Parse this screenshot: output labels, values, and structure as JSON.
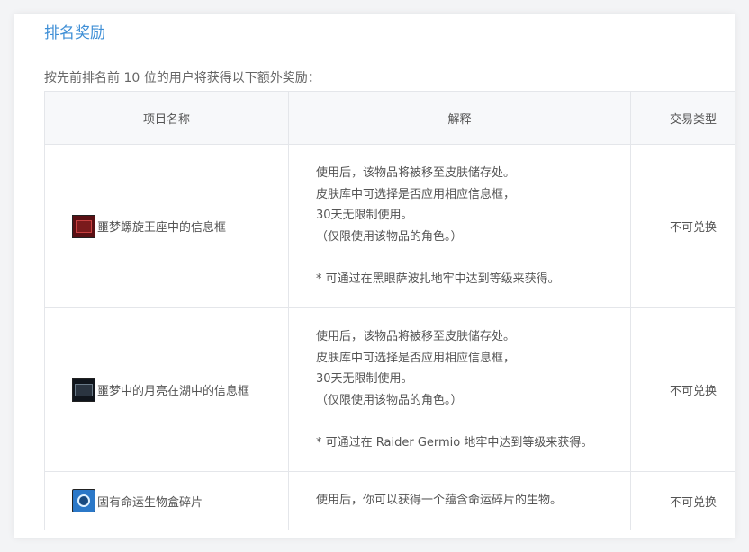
{
  "section": {
    "title": "排名奖励",
    "intro": "按先前排名前 10 位的用户将获得以下额外奖励："
  },
  "table": {
    "headers": [
      "项目名称",
      "解释",
      "交易类型"
    ],
    "rows": [
      {
        "icon": "frame-red-icon",
        "name": "噩梦螺旋王座中的信息框",
        "desc": [
          "使用后，该物品将被移至皮肤储存处。",
          "皮肤库中可选择是否应用相应信息框，",
          "30天无限制使用。",
          "（仅限使用该物品的角色。）",
          "* 可通过在黑眼萨波扎地牢中达到等级来获得。"
        ],
        "trade": "不可兑换"
      },
      {
        "icon": "frame-moon-icon",
        "name": "噩梦中的月亮在湖中的信息框",
        "desc": [
          "使用后，该物品将被移至皮肤储存处。",
          "皮肤库中可选择是否应用相应信息框，",
          "30天无限制使用。",
          "（仅限使用该物品的角色。）",
          "* 可通过在 Raider Germio 地牢中达到等级来获得。"
        ],
        "trade": "不可兑换"
      },
      {
        "icon": "destiny-box-icon",
        "name": "固有命运生物盒碎片",
        "desc": [
          "使用后，你可以获得一个蕴含命运碎片的生物。"
        ],
        "trade": "不可兑换"
      }
    ]
  },
  "colors": {
    "title": "#3f8fd6",
    "header_bg": "#f7f8fa",
    "border": "#e4e6ea"
  }
}
